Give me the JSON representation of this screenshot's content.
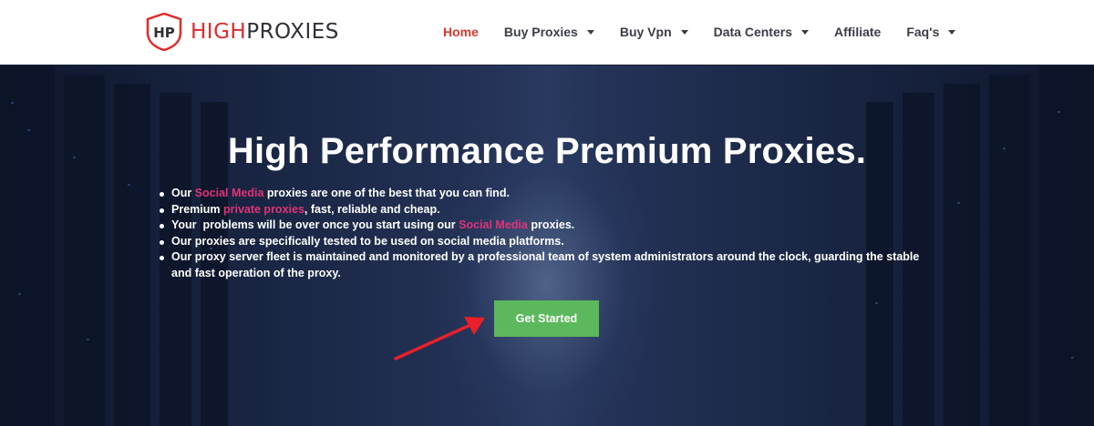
{
  "brand": {
    "logo_mark": "HP",
    "name_part1": "HIGH",
    "name_part2": "PROXIES",
    "accent_color": "#e02a2a"
  },
  "nav": {
    "items": [
      {
        "label": "Home",
        "active": true,
        "has_dropdown": false
      },
      {
        "label": "Buy Proxies",
        "active": false,
        "has_dropdown": true
      },
      {
        "label": "Buy Vpn",
        "active": false,
        "has_dropdown": true
      },
      {
        "label": "Data Centers",
        "active": false,
        "has_dropdown": true
      },
      {
        "label": "Affiliate",
        "active": false,
        "has_dropdown": false
      },
      {
        "label": "Faq's",
        "active": false,
        "has_dropdown": true
      }
    ]
  },
  "hero": {
    "title": "High Performance Premium Proxies.",
    "bullets": [
      {
        "before": "Our ",
        "highlight": "Social Media",
        "after": " proxies are one of the best that you can find."
      },
      {
        "before": "Premium ",
        "highlight": "private proxies",
        "after": ", fast, reliable and cheap."
      },
      {
        "before": "Your  problems will be over once you start using our ",
        "highlight": "Social Media",
        "after": " proxies."
      },
      {
        "before": "Our proxies are specifically tested to be used on social media platforms.",
        "highlight": "",
        "after": ""
      },
      {
        "before": "Our proxy server fleet is maintained and monitored by a professional team of system administrators around the clock, guarding the stable and fast operation of the proxy.",
        "highlight": "",
        "after": ""
      }
    ],
    "cta_label": "Get Started",
    "cta_color": "#5cb85c",
    "highlight_color": "#e0337a",
    "arrow_color": "#e8202a"
  }
}
